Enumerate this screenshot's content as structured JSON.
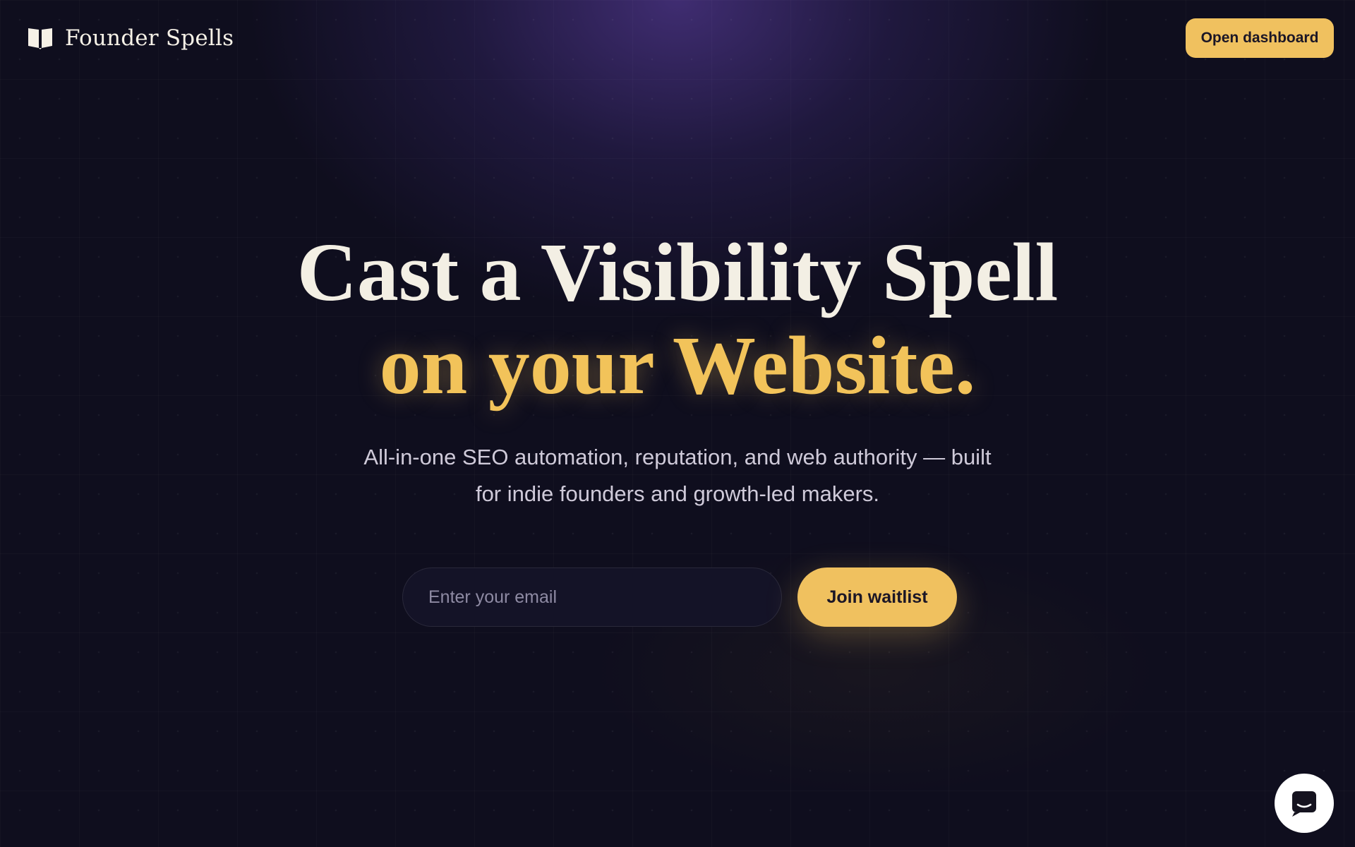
{
  "header": {
    "brand_name": "Founder Spells",
    "brand_icon": "open-book-icon",
    "dashboard_label": "Open dashboard"
  },
  "hero": {
    "headline_line1": "Cast a Visibility Spell",
    "headline_line2": "on your Website.",
    "subheadline_line1": "All-in-one SEO automation, reputation, and web authority — built",
    "subheadline_line2": "for indie founders and growth-led makers."
  },
  "waitlist": {
    "email_placeholder": "Enter your email",
    "email_value": "",
    "join_label": "Join waitlist"
  },
  "chat": {
    "icon": "chat-bubble-icon"
  },
  "colors": {
    "background": "#0f0e1e",
    "accent_gold": "#f0c15f",
    "headline_light": "#f3efe4",
    "glow_purple": "#483280"
  }
}
